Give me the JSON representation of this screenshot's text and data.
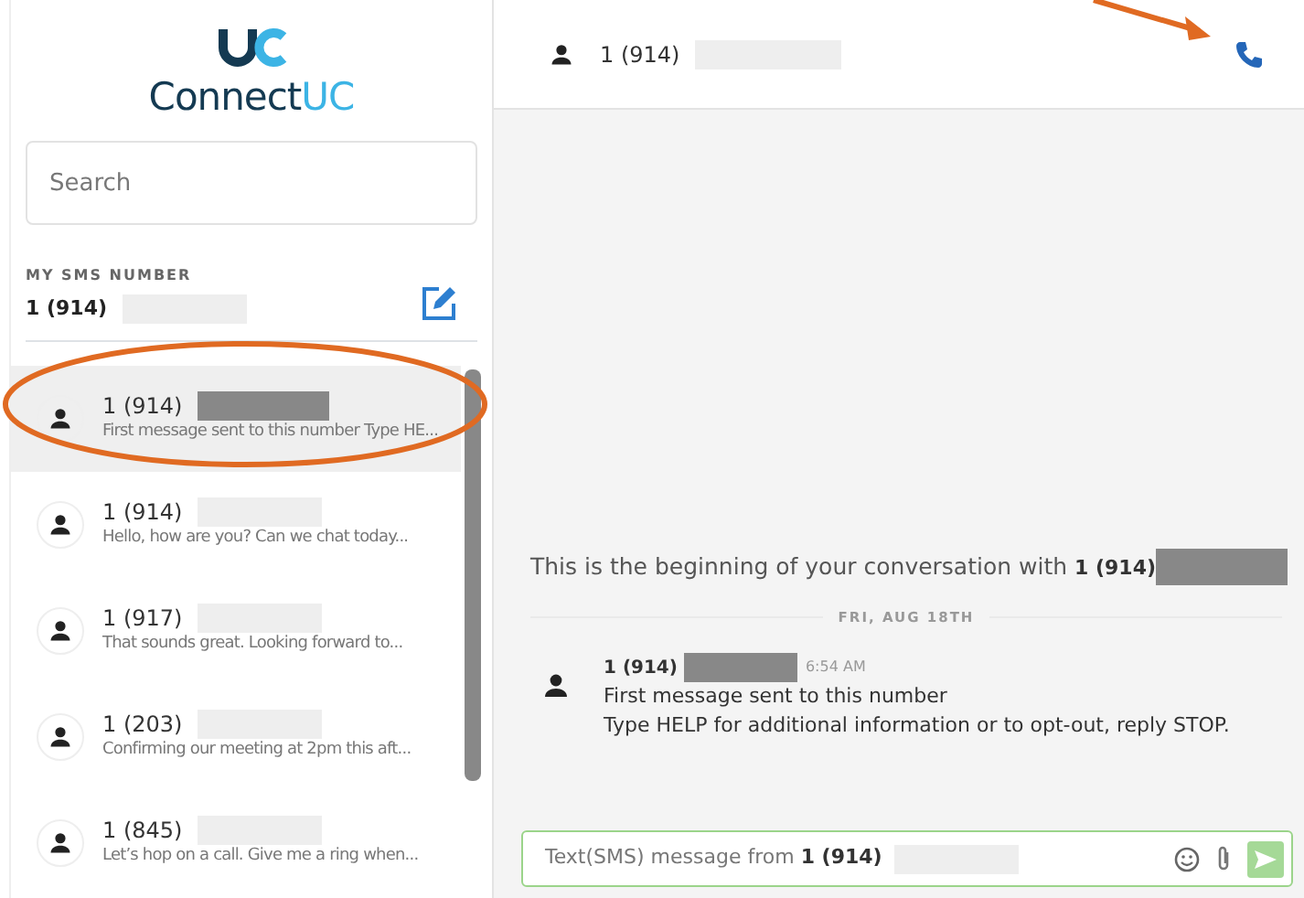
{
  "logo": {
    "word": "Connect",
    "accent": "UC"
  },
  "search": {
    "placeholder": "Search"
  },
  "my_sms_number": {
    "label": "MY SMS NUMBER",
    "number": "1 (914)"
  },
  "conversations": [
    {
      "number": "1 (914)",
      "preview": "First message sent to this number Type HE...",
      "selected": true
    },
    {
      "number": "1 (914)",
      "preview": "Hello, how are you? Can we chat today...",
      "selected": false
    },
    {
      "number": "1 (917)",
      "preview": "That sounds great. Looking forward to...",
      "selected": false
    },
    {
      "number": "1 (203)",
      "preview": "Confirming our meeting at 2pm this aft...",
      "selected": false
    },
    {
      "number": "1 (845)",
      "preview": "Let’s hop on a call. Give me a ring when...",
      "selected": false
    }
  ],
  "chat": {
    "contact": "1 (914)",
    "intro": "This is the beginning of your conversation with",
    "intro_number": "1 (914)",
    "date": "FRI, AUG 18TH",
    "messages": [
      {
        "sender": "1 (914)",
        "time": "6:54 AM",
        "lines": [
          "First message sent to this number",
          "Type HELP for additional information or to opt-out, reply STOP."
        ]
      }
    ],
    "composer": {
      "placeholder": "Text(SMS) message from",
      "number": "1 (914)"
    }
  }
}
